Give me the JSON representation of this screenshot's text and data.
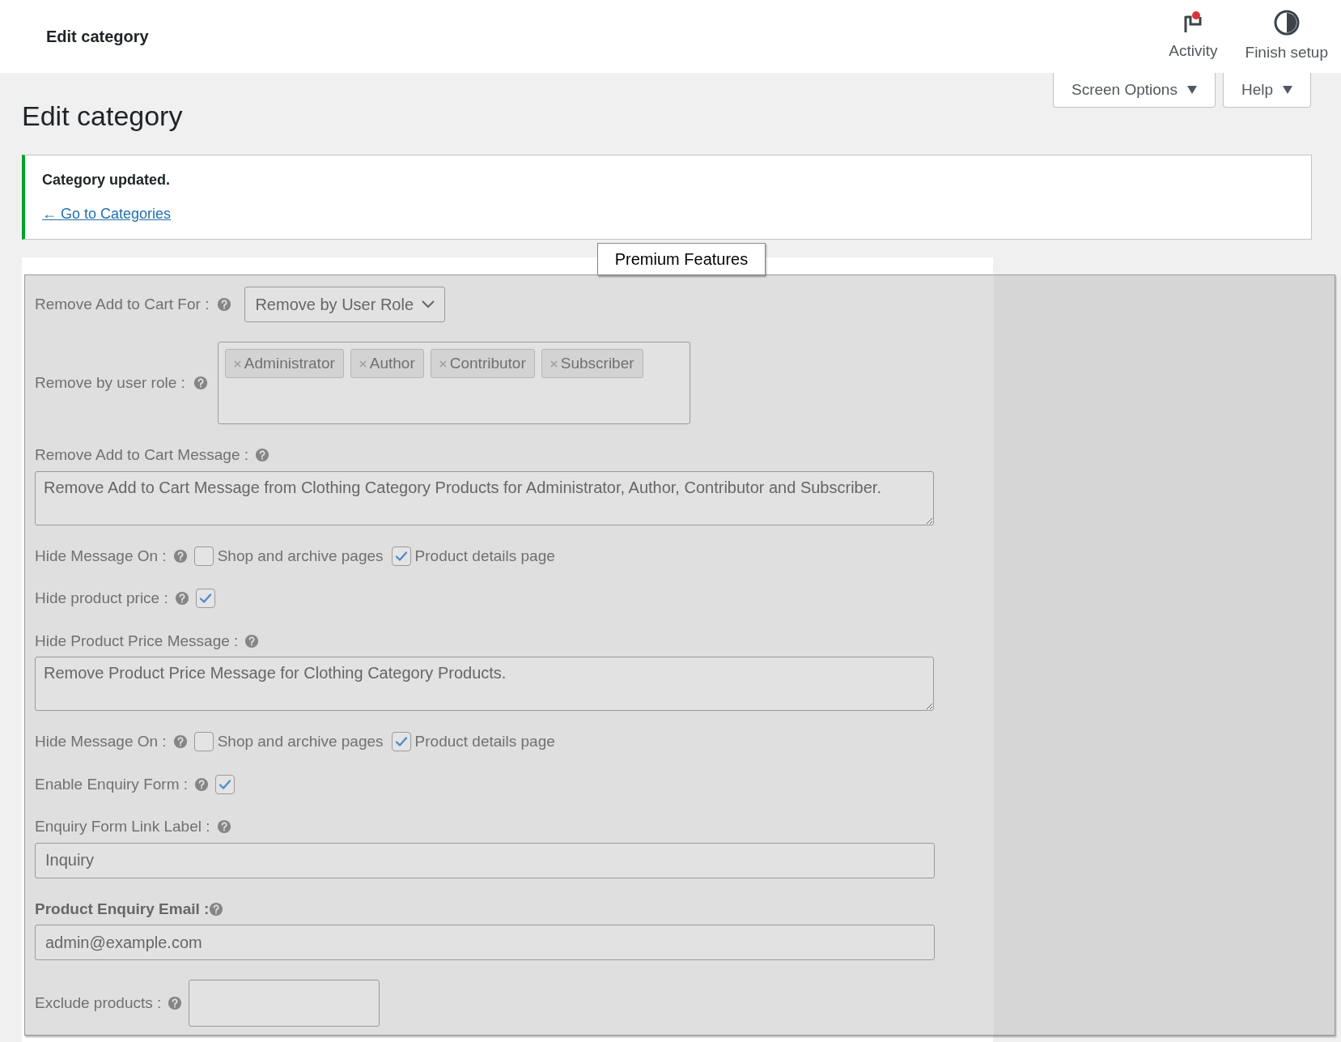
{
  "header": {
    "title": "Edit category",
    "actions": [
      {
        "kind": "activity",
        "label": "Activity",
        "unread": true
      },
      {
        "kind": "setup",
        "label": "Finish setup"
      }
    ]
  },
  "screen_tabs": [
    {
      "label": "Screen Options"
    },
    {
      "label": "Help"
    }
  ],
  "page_title": "Edit category",
  "notice": {
    "message": "Category updated.",
    "link": "← Go to Categories"
  },
  "premium_label": "Premium Features",
  "fields": [
    {
      "kind": "select",
      "label": "Remove Add to Cart For :",
      "bold": false,
      "value": "Remove by User Role"
    },
    {
      "kind": "tags",
      "label": "Remove by user role :",
      "bold": false,
      "tags": [
        "Administrator",
        "Author",
        "Contributor",
        "Subscriber"
      ]
    },
    {
      "kind": "textarea",
      "label": "Remove Add to Cart Message :",
      "bold": false,
      "value": "Remove Add to Cart Message from Clothing Category Products for Administrator, Author, Contributor and Subscriber."
    },
    {
      "kind": "checks",
      "label": "Hide Message On :",
      "bold": false,
      "options": [
        {
          "label": "Shop and archive pages",
          "checked": false
        },
        {
          "label": "Product details page",
          "checked": true
        }
      ]
    },
    {
      "kind": "checkbox",
      "label": "Hide product price :",
      "bold": false,
      "checked": true
    },
    {
      "kind": "textarea",
      "label": "Hide Product Price Message :",
      "bold": false,
      "value": "Remove Product Price Message for Clothing Category Products."
    },
    {
      "kind": "checks",
      "label": "Hide Message On :",
      "bold": false,
      "options": [
        {
          "label": "Shop and archive pages",
          "checked": false
        },
        {
          "label": "Product details page",
          "checked": true
        }
      ]
    },
    {
      "kind": "checkbox",
      "label": "Enable Enquiry Form :",
      "bold": false,
      "checked": true
    },
    {
      "kind": "input",
      "label": "Enquiry Form Link Label :",
      "bold": false,
      "value": "Inquiry"
    },
    {
      "kind": "input",
      "label": "Product Enquiry Email :",
      "bold": true,
      "value": "admin@example.com"
    },
    {
      "kind": "inline_input",
      "label": "Exclude products :",
      "bold": false
    }
  ]
}
